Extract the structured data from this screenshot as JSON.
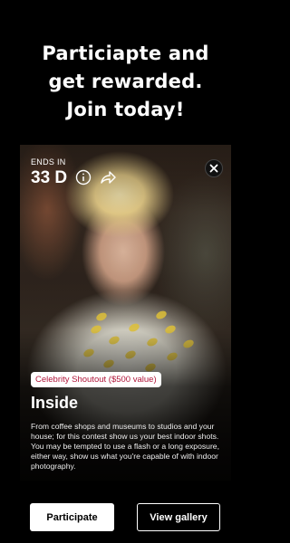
{
  "headline": {
    "line1": "Particiapte and",
    "line2": "get rewarded.",
    "line3": "Join today!"
  },
  "card": {
    "ends_label": "ENDS IN",
    "ends_value": "33 D",
    "info_icon": "info-circle-icon",
    "share_icon": "share-arrow-icon",
    "close_icon": "close-icon",
    "badge": "Celebrity Shoutout ($500 value)",
    "title": "Inside",
    "description": "From coffee shops and museums to studios and your house; for this contest show us your best indoor shots. You may be tempted to use a flash or a long exposure, either way, show us what you're capable of with indoor photography."
  },
  "actions": {
    "participate": "Participate",
    "view_gallery": "View gallery"
  },
  "colors": {
    "background": "#000000",
    "badge_text": "#b0163a",
    "primary_button": "#ffffff"
  }
}
